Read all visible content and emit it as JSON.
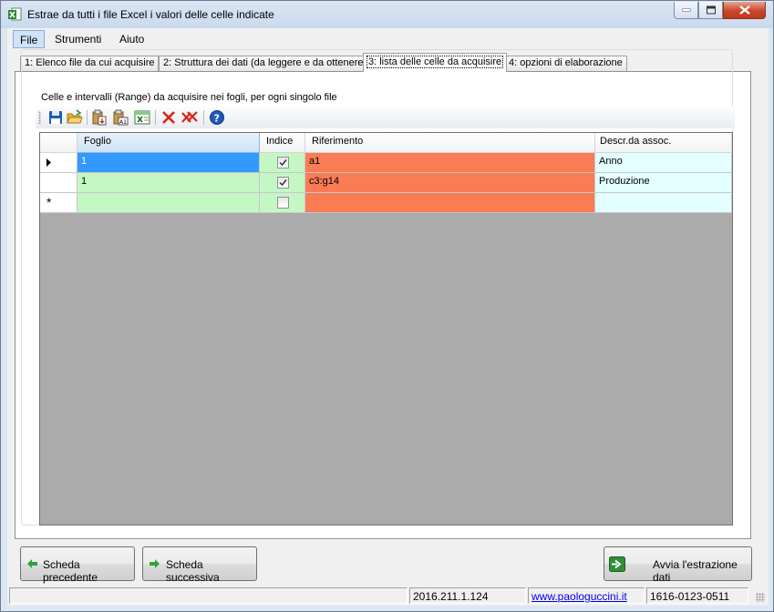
{
  "window": {
    "title": "Estrae da tutti i file Excel i valori delle celle indicate"
  },
  "menu": {
    "items": [
      "File",
      "Strumenti",
      "Aiuto"
    ]
  },
  "tabs": [
    "1: Elenco file da cui acquisire",
    "2: Struttura dei dati (da leggere e da ottenere)",
    "3: lista delle celle da acquisire",
    "4: opzioni di elaborazione"
  ],
  "selected_tab": 2,
  "group": {
    "label": "Celle e intervalli (Range) da acquisire nei fogli, per ogni singolo file"
  },
  "toolbar": {
    "icons": [
      "save-icon",
      "open-folder-icon",
      "paste-icon",
      "paste-a1-icon",
      "excel-icon",
      "delete-icon",
      "delete-all-icon",
      "help-icon"
    ]
  },
  "grid": {
    "columns": [
      "Foglio",
      "Indice",
      "Riferimento",
      "Descr.da assoc."
    ],
    "rows": [
      {
        "foglio": "1",
        "indice": true,
        "riferimento": "a1",
        "descr": "Anno"
      },
      {
        "foglio": "1",
        "indice": true,
        "riferimento": "c3:g14",
        "descr": "Produzione"
      }
    ],
    "new_row_marker": "*",
    "colors": {
      "foglio": "#c5f7c5",
      "riferimento": "#f97c55",
      "descr": "#e3ffff",
      "selection": "#3399ff",
      "empty_area": "#ababab"
    }
  },
  "buttons": {
    "prev": "Scheda precedente",
    "next": "Scheda successiva",
    "run": "Avvia l'estrazione dati"
  },
  "status": {
    "main": "",
    "version": "2016.211.1.124",
    "website": "www.paologuccini.it",
    "code": "1616-0123-0511"
  }
}
